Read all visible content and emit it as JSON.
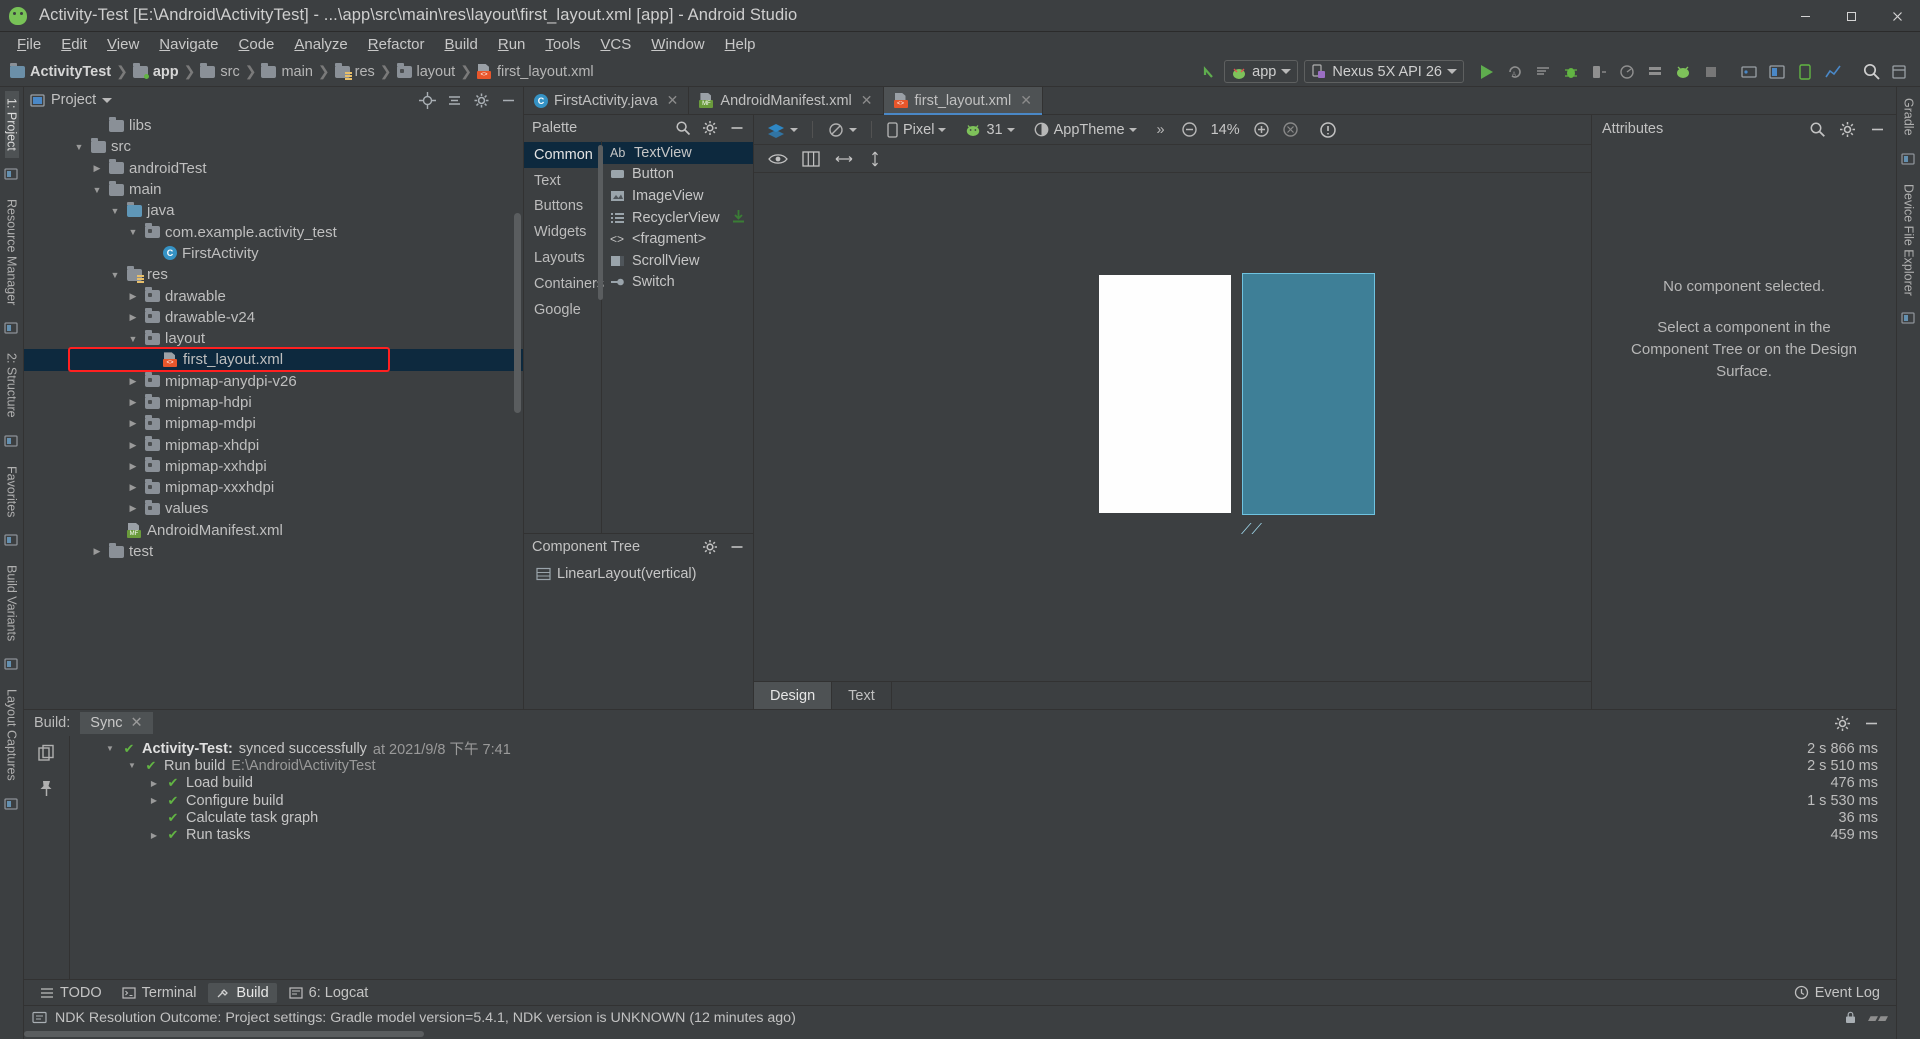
{
  "window": {
    "title": "Activity-Test [E:\\Android\\ActivityTest] - ...\\app\\src\\main\\res\\layout\\first_layout.xml [app] - Android Studio",
    "minimize": "—",
    "maximize": "❐",
    "close": "✕"
  },
  "menubar": [
    "File",
    "Edit",
    "View",
    "Navigate",
    "Code",
    "Analyze",
    "Refactor",
    "Build",
    "Run",
    "Tools",
    "VCS",
    "Window",
    "Help"
  ],
  "breadcrumbs": [
    {
      "label": "ActivityTest",
      "icon": "module-folder-icon"
    },
    {
      "label": "app",
      "icon": "app-module-icon"
    },
    {
      "label": "src",
      "icon": "folder-icon"
    },
    {
      "label": "main",
      "icon": "folder-icon"
    },
    {
      "label": "res",
      "icon": "res-folder-icon"
    },
    {
      "label": "layout",
      "icon": "folder-icon"
    },
    {
      "label": "first_layout.xml",
      "icon": "xml-file-icon"
    }
  ],
  "toolbar": {
    "run_config": "app",
    "device": "Nexus 5X API 26",
    "run_tooltip": "Run",
    "search_icon": "search-icon",
    "icons": [
      "run-icon",
      "apply-changes-icon",
      "apply-code-changes-icon",
      "debug-icon",
      "attach-debugger-icon",
      "profile-icon",
      "sdk-manager-icon",
      "avd-manager-icon",
      "stop-icon",
      "sync-gradle-icon",
      "layout-inspector-icon",
      "device-file-explorer-icon",
      "search-everywhere-icon",
      "settings-icon"
    ]
  },
  "left_rail": [
    {
      "label": "1: Project",
      "icon": "project-icon",
      "selected": true
    },
    {
      "label": "Resource Manager",
      "icon": "resource-manager-icon",
      "selected": false
    },
    {
      "label": "2: Structure",
      "icon": "structure-icon",
      "selected": false
    },
    {
      "label": "Favorites",
      "icon": "favorites-icon",
      "selected": false
    },
    {
      "label": "Build Variants",
      "icon": "build-variants-icon",
      "selected": false
    },
    {
      "label": "Layout Captures",
      "icon": "layout-captures-icon",
      "selected": false
    }
  ],
  "right_rail": [
    {
      "label": "Gradle",
      "icon": "gradle-icon"
    },
    {
      "label": "Device File Explorer",
      "icon": "device-file-explorer-icon"
    }
  ],
  "project_panel": {
    "title": "Project",
    "icons": [
      "locate-icon",
      "collapse-all-icon",
      "settings-icon",
      "hide-icon"
    ],
    "tree": [
      {
        "label": "libs",
        "indent": 3,
        "arrow": "none",
        "icon": "folder-icon"
      },
      {
        "label": "src",
        "indent": 2,
        "arrow": "open",
        "icon": "folder-icon"
      },
      {
        "label": "androidTest",
        "indent": 3,
        "arrow": "closed",
        "icon": "folder-icon"
      },
      {
        "label": "main",
        "indent": 3,
        "arrow": "open",
        "icon": "folder-icon"
      },
      {
        "label": "java",
        "indent": 4,
        "arrow": "open",
        "icon": "java-folder-icon"
      },
      {
        "label": "com.example.activity_test",
        "indent": 5,
        "arrow": "open",
        "icon": "package-icon"
      },
      {
        "label": "FirstActivity",
        "indent": 6,
        "arrow": "none",
        "icon": "class-icon"
      },
      {
        "label": "res",
        "indent": 4,
        "arrow": "open",
        "icon": "res-folder-icon"
      },
      {
        "label": "drawable",
        "indent": 5,
        "arrow": "closed",
        "icon": "package-icon"
      },
      {
        "label": "drawable-v24",
        "indent": 5,
        "arrow": "closed",
        "icon": "package-icon"
      },
      {
        "label": "layout",
        "indent": 5,
        "arrow": "open",
        "icon": "package-icon"
      },
      {
        "label": "first_layout.xml",
        "indent": 6,
        "arrow": "none",
        "icon": "xml-file-icon",
        "selected": true,
        "highlighted": true
      },
      {
        "label": "mipmap-anydpi-v26",
        "indent": 5,
        "arrow": "closed",
        "icon": "package-icon"
      },
      {
        "label": "mipmap-hdpi",
        "indent": 5,
        "arrow": "closed",
        "icon": "package-icon"
      },
      {
        "label": "mipmap-mdpi",
        "indent": 5,
        "arrow": "closed",
        "icon": "package-icon"
      },
      {
        "label": "mipmap-xhdpi",
        "indent": 5,
        "arrow": "closed",
        "icon": "package-icon"
      },
      {
        "label": "mipmap-xxhdpi",
        "indent": 5,
        "arrow": "closed",
        "icon": "package-icon"
      },
      {
        "label": "mipmap-xxxhdpi",
        "indent": 5,
        "arrow": "closed",
        "icon": "package-icon"
      },
      {
        "label": "values",
        "indent": 5,
        "arrow": "closed",
        "icon": "package-icon"
      },
      {
        "label": "AndroidManifest.xml",
        "indent": 4,
        "arrow": "none",
        "icon": "manifest-file-icon"
      },
      {
        "label": "test",
        "indent": 3,
        "arrow": "closed",
        "icon": "folder-icon"
      }
    ]
  },
  "editor_tabs": [
    {
      "label": "FirstActivity.java",
      "icon": "class-icon",
      "active": false
    },
    {
      "label": "AndroidManifest.xml",
      "icon": "manifest-file-icon",
      "active": false
    },
    {
      "label": "first_layout.xml",
      "icon": "xml-file-icon",
      "active": true
    }
  ],
  "palette": {
    "title": "Palette",
    "search_icon": "search-icon",
    "settings_icon": "settings-icon",
    "hide_icon": "hide-icon",
    "categories": [
      {
        "label": "Common",
        "selected": true
      },
      {
        "label": "Text",
        "selected": false
      },
      {
        "label": "Buttons",
        "selected": false
      },
      {
        "label": "Widgets",
        "selected": false
      },
      {
        "label": "Layouts",
        "selected": false
      },
      {
        "label": "Containers",
        "selected": false
      },
      {
        "label": "Google",
        "selected": false
      }
    ],
    "items": [
      {
        "label": "TextView",
        "icon": "textview-icon",
        "selected": true
      },
      {
        "label": "Button",
        "icon": "button-icon",
        "selected": false
      },
      {
        "label": "ImageView",
        "icon": "imageview-icon",
        "selected": false
      },
      {
        "label": "RecyclerView",
        "icon": "recyclerview-icon",
        "selected": false,
        "download": true
      },
      {
        "label": "<fragment>",
        "icon": "fragment-icon",
        "selected": false
      },
      {
        "label": "ScrollView",
        "icon": "scrollview-icon",
        "selected": false
      },
      {
        "label": "Switch",
        "icon": "switch-icon",
        "selected": false
      }
    ]
  },
  "component_tree": {
    "title": "Component Tree",
    "settings_icon": "settings-icon",
    "hide_icon": "hide-icon",
    "rows": [
      {
        "label": "LinearLayout(vertical)",
        "icon": "linearlayout-icon"
      }
    ]
  },
  "surface_toolbar": {
    "design_mode_icon": "design-surface-mode-icon",
    "orientation_icon": "orientation-icon",
    "device": "Pixel",
    "api_level": "31",
    "theme": "AppTheme",
    "overflow": "»",
    "zoom_out_icon": "zoom-out-icon",
    "zoom_level": "14%",
    "zoom_in_icon": "zoom-in-icon",
    "zoom_fit_icon": "zoom-to-fit-icon",
    "issues_icon": "issues-panel-icon",
    "row2_icons": [
      "eye-icon",
      "blueprint-icon",
      "horizontal-constraint-icon",
      "vertical-constraint-icon"
    ]
  },
  "design_bottom_tabs": [
    {
      "label": "Design",
      "active": true
    },
    {
      "label": "Text",
      "active": false
    }
  ],
  "attributes": {
    "title": "Attributes",
    "search_icon": "search-icon",
    "settings_icon": "settings-icon",
    "hide_icon": "hide-icon",
    "empty_title": "No component selected.",
    "empty_body": "Select a component in the Component Tree or on the Design Surface."
  },
  "build_panel": {
    "label": "Build:",
    "tab": "Sync",
    "tab_close": "✕",
    "settings_icon": "settings-icon",
    "hide_icon": "hide-icon",
    "rail_icons": [
      "toggle-view-icon",
      "pin-tab-icon"
    ],
    "rows": [
      {
        "tri": "open",
        "check": true,
        "bold": "Activity-Test:",
        "text": " synced successfully",
        "muted": " at 2021/9/8 下午 7:41",
        "indent": 0,
        "time": "2 s 866 ms"
      },
      {
        "tri": "open",
        "check": true,
        "bold": "",
        "text": "Run build",
        "muted": " E:\\Android\\ActivityTest",
        "indent": 1,
        "time": "2 s 510 ms"
      },
      {
        "tri": "closed",
        "check": true,
        "bold": "",
        "text": "Load build",
        "muted": "",
        "indent": 2,
        "time": "476 ms"
      },
      {
        "tri": "closed",
        "check": true,
        "bold": "",
        "text": "Configure build",
        "muted": "",
        "indent": 2,
        "time": "1 s 530 ms"
      },
      {
        "tri": "none",
        "check": true,
        "bold": "",
        "text": "Calculate task graph",
        "muted": "",
        "indent": 2,
        "time": "36 ms"
      },
      {
        "tri": "closed",
        "check": true,
        "bold": "",
        "text": "Run tasks",
        "muted": "",
        "indent": 2,
        "time": "459 ms"
      }
    ]
  },
  "toolwindow_bar": {
    "left": [
      {
        "label": "TODO",
        "icon": "todo-icon",
        "active": false
      },
      {
        "label": "Terminal",
        "icon": "terminal-icon",
        "active": false
      },
      {
        "label": "Build",
        "icon": "build-icon",
        "active": true
      },
      {
        "label": "6: Logcat",
        "icon": "logcat-icon",
        "active": false
      }
    ],
    "right": [
      {
        "label": "Event Log",
        "icon": "event-log-icon"
      }
    ]
  },
  "statusbar": {
    "icon": "info-icon",
    "message": "NDK Resolution Outcome: Project settings: Gradle model version=5.4.1, NDK version is UNKNOWN (12 minutes ago)",
    "lock_icon": "lock-icon",
    "memory_icon": "memory-indicator-icon"
  },
  "colors": {
    "background": "#3c3f41",
    "selection": "#0d293e",
    "highlight_red": "#ff2020",
    "accent_blue": "#4a88c7",
    "green_check": "#62b543",
    "preview_blue": "#3e7f97"
  }
}
